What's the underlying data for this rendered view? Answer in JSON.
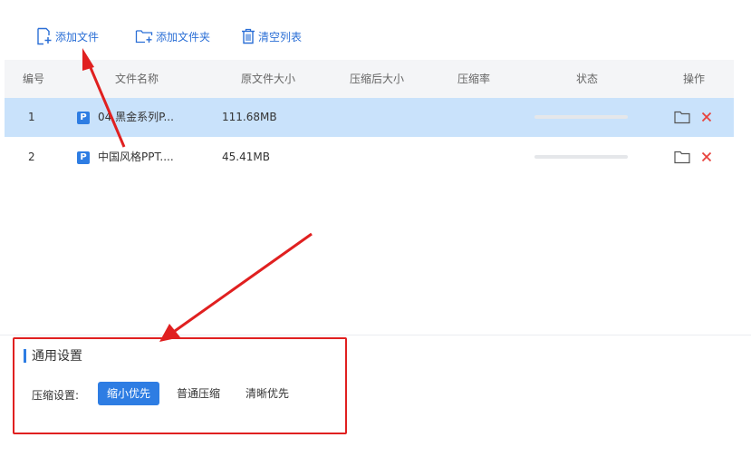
{
  "toolbar": {
    "add_file": "添加文件",
    "add_folder": "添加文件夹",
    "clear_list": "清空列表"
  },
  "table": {
    "columns": [
      "编号",
      "文件名称",
      "原文件大小",
      "压缩后大小",
      "压缩率",
      "状态",
      "操作"
    ],
    "rows": [
      {
        "index": "1",
        "badge": "P",
        "name": "04 黑金系列P...",
        "original_size": "111.68MB",
        "compressed_size": "",
        "ratio": "",
        "progress": 0,
        "selected": true
      },
      {
        "index": "2",
        "badge": "P",
        "name": "中国风格PPT....",
        "original_size": "45.41MB",
        "compressed_size": "",
        "ratio": "",
        "progress": 0,
        "selected": false
      }
    ]
  },
  "settings": {
    "title": "通用设置",
    "compress_label": "压缩设置:",
    "options": [
      "缩小优先",
      "普通压缩",
      "清晰优先"
    ],
    "selected_option": "缩小优先"
  },
  "colors": {
    "accent": "#2e7de3",
    "toolbar_text": "#2b6fd6",
    "selected_row": "#c9e2fb",
    "header_bg": "#f4f5f7",
    "annotation": "#e02020",
    "delete": "#e8423c"
  },
  "icons": {
    "add_file": "add-file-icon",
    "add_folder": "add-folder-icon",
    "clear": "trash-icon",
    "open_folder": "folder-icon",
    "remove": "close-icon"
  }
}
